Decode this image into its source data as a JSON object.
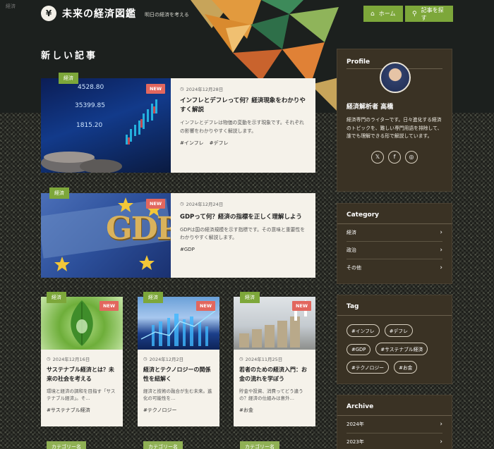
{
  "corner_label": "経済",
  "header": {
    "logo_glyph": "¥",
    "site_title": "未来の経済図鑑",
    "tagline": "明日の経済を考える",
    "nav": [
      {
        "label": "ホーム",
        "icon": "home-icon"
      },
      {
        "label": "記事を探す",
        "icon": "search-icon"
      }
    ]
  },
  "section_title": "新しい記事",
  "articles_wide": [
    {
      "category": "経済",
      "badge": "NEW",
      "date": "2024年12月28日",
      "title": "インフレとデフレって何？経済現象をわかりやすく解説",
      "excerpt": "インフレとデフレは物価の変動を示す現象です。それぞれの影響をわかりやすく解説します。",
      "tags": [
        "#インフレ",
        "#デフレ"
      ],
      "thumb_text": [
        "4528.80",
        "35399.85",
        "1815.20"
      ]
    },
    {
      "category": "経済",
      "badge": "NEW",
      "date": "2024年12月24日",
      "title": "GDPって何？経済の指標を正しく理解しよう",
      "excerpt": "GDPは国の経済規模を示す指標です。その意味と重要性をわかりやすく解説します。",
      "tags": [
        "#GDP"
      ],
      "thumb_text": [
        "GDP"
      ]
    }
  ],
  "articles_small": [
    {
      "category": "経済",
      "badge": "NEW",
      "date": "2024年12月16日",
      "title": "サステナブル経済とは？未来の社会を考える",
      "excerpt": "環境と経済の調和を目指す「サステナブル経済」。そ…",
      "tags": [
        "#サステナブル経済"
      ]
    },
    {
      "category": "経済",
      "badge": "NEW",
      "date": "2024年12月2日",
      "title": "経済とテクノロジーの関係性を紐解く",
      "excerpt": "経済と技術の融合が生む未来。進化の可能性を…",
      "tags": [
        "#テクノロジー"
      ]
    },
    {
      "category": "経済",
      "badge": "NEW",
      "date": "2024年11月25日",
      "title": "若者のための経済入門：お金の流れを学ぼう",
      "excerpt": "貯金や投資、消費ってどう違うの？経済の仕組みは意外…",
      "tags": [
        "#お金"
      ]
    }
  ],
  "bottom_labels": [
    "カテゴリー名",
    "カテゴリー名",
    "カテゴリー名"
  ],
  "sidebar": {
    "profile": {
      "title": "Profile",
      "name": "経済解析者 高橋",
      "bio": "経済専門のライターです。日々進化する経済のトピックを、難しい専門用語を排除して、誰でも理解できる形で解説しています。",
      "social": [
        {
          "icon": "x-icon",
          "glyph": "𝕏"
        },
        {
          "icon": "facebook-icon",
          "glyph": "f"
        },
        {
          "icon": "instagram-icon",
          "glyph": "◎"
        }
      ]
    },
    "category": {
      "title": "Category",
      "items": [
        "経済",
        "政治",
        "その他"
      ]
    },
    "tag": {
      "title": "Tag",
      "items": [
        "#インフレ",
        "#デフレ",
        "#GDP",
        "#サステナブル経済",
        "#テクノロジー",
        "#お金"
      ]
    },
    "archive": {
      "title": "Archive",
      "items": [
        "2024年",
        "2023年"
      ]
    }
  },
  "colors": {
    "accent_green": "#7da73a",
    "new_badge": "#e2675e",
    "card_bg": "#f5f2ea",
    "panel_bg": "#3a3224"
  }
}
